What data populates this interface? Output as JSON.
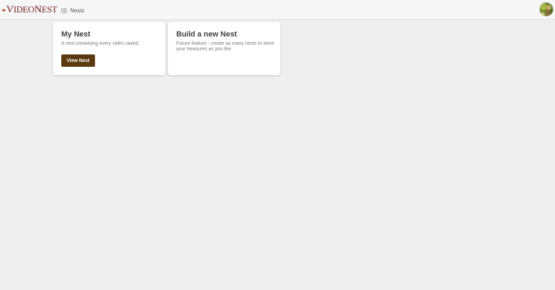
{
  "header": {
    "logo": {
      "text_first": "V",
      "text_mid": "IDEO",
      "text_n": "N",
      "text_last": "EST",
      "brand_color": "#7a2020",
      "mark_icon": "nest-eggs-icon"
    },
    "nav": {
      "label": "Nests",
      "icon": "list-menu-icon"
    },
    "avatar_icon": "user-avatar"
  },
  "cards": [
    {
      "title": "My Nest",
      "description": "A nest containing every video saved.",
      "button_label": "View Nest"
    },
    {
      "title": "Build a new Nest",
      "description": "Future feature - create as many nests to store your treasures as you like"
    }
  ],
  "colors": {
    "page_background": "#efefef",
    "topbar_background": "#f6f6f6",
    "card_background": "#ffffff",
    "button_background": "#5c3a10",
    "button_text": "#ffffff"
  }
}
